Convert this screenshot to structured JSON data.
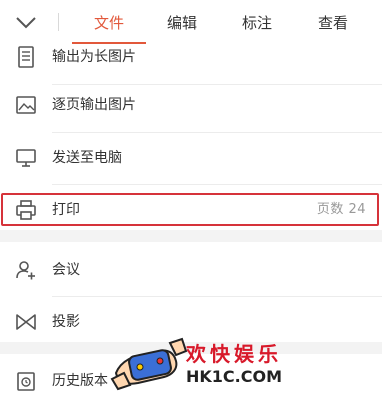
{
  "tabs": [
    {
      "label": "文件",
      "active": true
    },
    {
      "label": "编辑",
      "active": false
    },
    {
      "label": "标注",
      "active": false
    },
    {
      "label": "查看",
      "active": false
    }
  ],
  "colors": {
    "accent": "#e2583b",
    "highlight_border": "#d6333a",
    "watermark_red": "#d8192a"
  },
  "menu": {
    "items": [
      {
        "label": "输出为长图片",
        "icon": "long-image-icon"
      },
      {
        "label": "逐页输出图片",
        "icon": "image-icon"
      },
      {
        "label": "发送至电脑",
        "icon": "monitor-icon"
      },
      {
        "label": "打印",
        "icon": "printer-icon",
        "meta": "页数 24"
      },
      {
        "label": "会议",
        "icon": "meeting-icon"
      },
      {
        "label": "投影",
        "icon": "projection-icon"
      },
      {
        "label": "历史版本",
        "icon": "history-icon"
      }
    ]
  },
  "watermark": {
    "title": "欢快娱乐",
    "site": "HK1C.COM"
  }
}
